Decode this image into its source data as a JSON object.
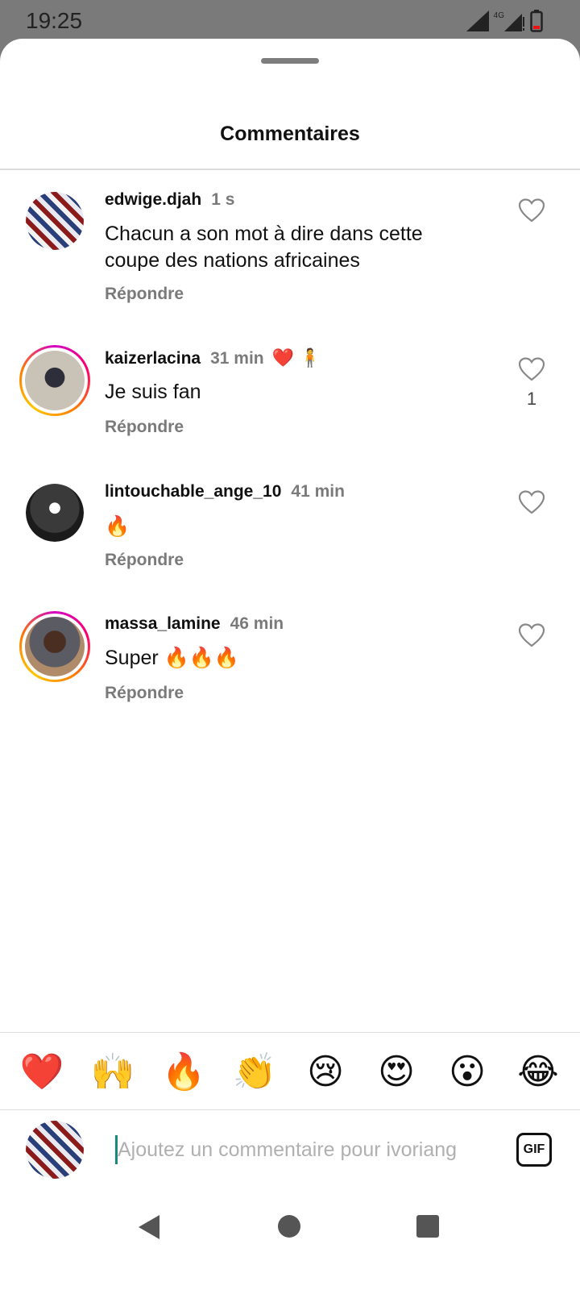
{
  "status_bar": {
    "time": "19:25",
    "network": "4G",
    "icons": [
      "signal-icon",
      "signal-4g-icon",
      "battery-low-icon"
    ]
  },
  "sheet": {
    "title": "Commentaires"
  },
  "comments": [
    {
      "username": "edwige.djah",
      "time": "1 s",
      "text": "Chacun a son mot à dire dans cette coupe des nations africaines",
      "reply_label": "Répondre",
      "likes": "",
      "avatar_ring": false,
      "badges": []
    },
    {
      "username": "kaizerlacina",
      "time": "31 min",
      "text": "Je suis fan",
      "reply_label": "Répondre",
      "likes": "1",
      "avatar_ring": true,
      "badges": [
        "❤️",
        "🧍"
      ]
    },
    {
      "username": "lintouchable_ange_10",
      "time": "41 min",
      "text": "🔥",
      "reply_label": "Répondre",
      "likes": "",
      "avatar_ring": false,
      "badges": []
    },
    {
      "username": "massa_lamine",
      "time": "46 min",
      "text": "Super 🔥🔥🔥",
      "reply_label": "Répondre",
      "likes": "",
      "avatar_ring": true,
      "badges": []
    }
  ],
  "emoji_bar": [
    "❤️",
    "🙌",
    "🔥",
    "👏",
    "😢",
    "😍",
    "😮",
    "😂"
  ],
  "input": {
    "placeholder": "Ajoutez un commentaire pour ivoriang",
    "value": "",
    "gif_label": "GIF"
  },
  "colors": {
    "accent_ring_start": "#d300c5",
    "accent_ring_end": "#ffc500",
    "secondary_text": "#7a7a7a",
    "cursor": "#1a8a7a"
  }
}
